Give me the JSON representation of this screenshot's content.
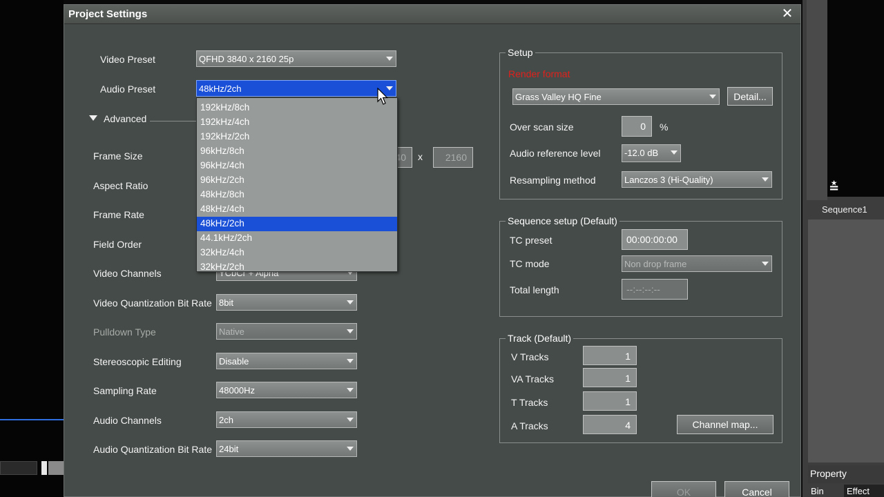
{
  "dialog": {
    "title": "Project Settings"
  },
  "left": {
    "video_preset_label": "Video Preset",
    "video_preset_value": "QFHD 3840 x 2160 25p",
    "audio_preset_label": "Audio Preset",
    "audio_preset_value": "48kHz/2ch",
    "advanced_label": "Advanced",
    "frame_size_label": "Frame Size",
    "frame_size_width": "3840",
    "frame_size_x": "x",
    "frame_size_height": "2160",
    "aspect_ratio_label": "Aspect Ratio",
    "frame_rate_label": "Frame Rate",
    "field_order_label": "Field Order",
    "video_channels_label": "Video Channels",
    "video_channels_value": "YCbCr + Alpha",
    "video_quant_label": "Video Quantization Bit Rate",
    "video_quant_value": "8bit",
    "pulldown_label": "Pulldown Type",
    "pulldown_value": "Native",
    "stereo_label": "Stereoscopic Editing",
    "stereo_value": "Disable",
    "sampling_label": "Sampling Rate",
    "sampling_value": "48000Hz",
    "audio_channels_label": "Audio Channels",
    "audio_channels_value": "2ch",
    "audio_quant_label": "Audio Quantization Bit Rate",
    "audio_quant_value": "24bit"
  },
  "audio_preset_options": [
    "192kHz/8ch",
    "192kHz/4ch",
    "192kHz/2ch",
    "96kHz/8ch",
    "96kHz/4ch",
    "96kHz/2ch",
    "48kHz/8ch",
    "48kHz/4ch",
    "48kHz/2ch",
    "44.1kHz/2ch",
    "32kHz/4ch",
    "32kHz/2ch"
  ],
  "audio_preset_selected_index": 8,
  "setup": {
    "title": "Setup",
    "render_format_label": "Render format",
    "render_format_value": "Grass Valley HQ Fine",
    "detail_button": "Detail...",
    "overscan_label": "Over scan size",
    "overscan_value": "0",
    "overscan_unit": "%",
    "audio_ref_label": "Audio reference level",
    "audio_ref_value": "-12.0 dB",
    "resampling_label": "Resampling method",
    "resampling_value": "Lanczos 3 (Hi-Quality)"
  },
  "sequence": {
    "title": "Sequence setup (Default)",
    "tc_preset_label": "TC preset",
    "tc_preset_value": "00:00:00:00",
    "tc_mode_label": "TC mode",
    "tc_mode_value": "Non drop frame",
    "total_length_label": "Total length",
    "total_length_value": "--:--:--:--"
  },
  "track": {
    "title": "Track (Default)",
    "v_label": "V Tracks",
    "v_value": "1",
    "va_label": "VA Tracks",
    "va_value": "1",
    "t_label": "T Tracks",
    "t_value": "1",
    "a_label": "A Tracks",
    "a_value": "4",
    "channel_map_button": "Channel map..."
  },
  "buttons": {
    "ok": "OK",
    "cancel": "Cancel"
  },
  "background": {
    "sequence_label": "Sequence1",
    "property_tab": "Property",
    "bin_tab": "Bin",
    "effect_tab": "Effect"
  },
  "colors": {
    "dialog_bg": "#454b48",
    "selection": "#1a4fd8",
    "render_format_label": "#e0201c"
  }
}
